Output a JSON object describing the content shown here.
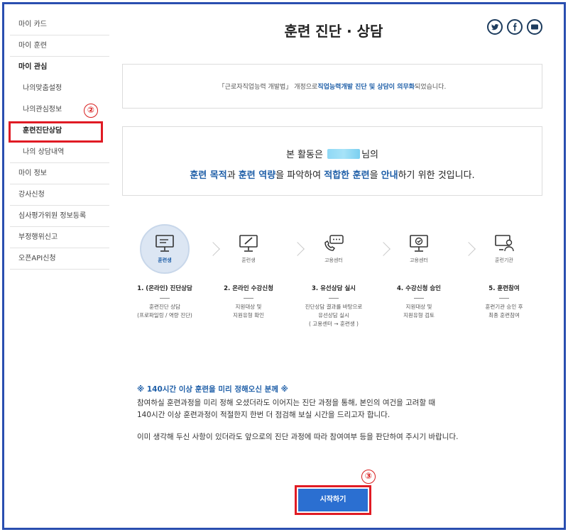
{
  "sidebar": {
    "items": [
      {
        "label": "마이 카드"
      },
      {
        "label": "마이 훈련"
      },
      {
        "label": "마이 관심"
      },
      {
        "label": "나의맞춤설정"
      },
      {
        "label": "나의관심정보"
      },
      {
        "label": "훈련진단상담"
      },
      {
        "label": "나의 상담내역"
      },
      {
        "label": "마이 정보"
      },
      {
        "label": "강사신청"
      },
      {
        "label": "심사평가위원 정보등록"
      },
      {
        "label": "부정행위신고"
      },
      {
        "label": "오픈API신청"
      }
    ]
  },
  "markers": {
    "m2": "②",
    "m3": "③"
  },
  "header": {
    "title": "훈련 진단 · 상담",
    "share_icons": [
      "twitter-icon",
      "facebook-icon",
      "message-icon"
    ]
  },
  "notice": {
    "prefix": "「근로자직업능력 개발법」 개정으로 ",
    "highlight": "직업능력개발 진단 및 상담이 의무화",
    "suffix": " 되었습니다."
  },
  "intro": {
    "line1_prefix": "본 활동은",
    "line1_suffix": "님의",
    "w1": "훈련 목적",
    "t1": "과 ",
    "w2": "훈련 역량",
    "t2": "을 파악하여 ",
    "w3": "적합한 훈련",
    "t3": "을 ",
    "w4": "안내",
    "t4": "하기 위한 것입니다."
  },
  "steps": [
    {
      "role": "훈련생",
      "title": "1. (온라인) 진단상담",
      "desc1": "훈련진단 상담",
      "desc2": "(프로파일링 / 역량 진단)",
      "desc3": "",
      "icon": "monitor-icon"
    },
    {
      "role": "훈련생",
      "title": "2. 온라인 수강신청",
      "desc1": "지원대상 및",
      "desc2": "지원유형 확인",
      "desc3": "",
      "icon": "pen-monitor-icon"
    },
    {
      "role": "고용센터",
      "title": "3. 유선상담 실시",
      "desc1": "진단상담 결과를 바탕으로",
      "desc2": "유선상담 실시",
      "desc3": "( 고용센터 → 훈련생 )",
      "icon": "phone-chat-icon"
    },
    {
      "role": "고용센터",
      "title": "4. 수강신청 승인",
      "desc1": "지원대상 및",
      "desc2": "지원유형 검토",
      "desc3": "",
      "icon": "check-monitor-icon"
    },
    {
      "role": "훈련기관",
      "title": "5. 훈련참여",
      "desc1": "훈련기관 승인 후",
      "desc2": "최종 훈련참여",
      "desc3": "",
      "icon": "person-monitor-icon"
    }
  ],
  "info": {
    "head": "※ 140시간 이상 훈련을 미리 정해오신 분께 ※",
    "p1": "참여하실 훈련과정을 미리 정해 오셨더라도 이어지는 진단 과정을 통해, 본인의 여건을 고려할 때",
    "p2": "140시간 이상 훈련과정이 적절한지 한번 더 점검해 보실 시간을 드리고자 합니다.",
    "p3": "이미 생각해 두신 사항이 있더라도 앞으로의 진단 과정에 따라 참여여부 등을 판단하여 주시기 바랍니다."
  },
  "start_button": {
    "label": "시작하기"
  },
  "colors": {
    "accent": "#1f5fa8",
    "button": "#2b6fd1",
    "highlight": "#e01b24"
  }
}
